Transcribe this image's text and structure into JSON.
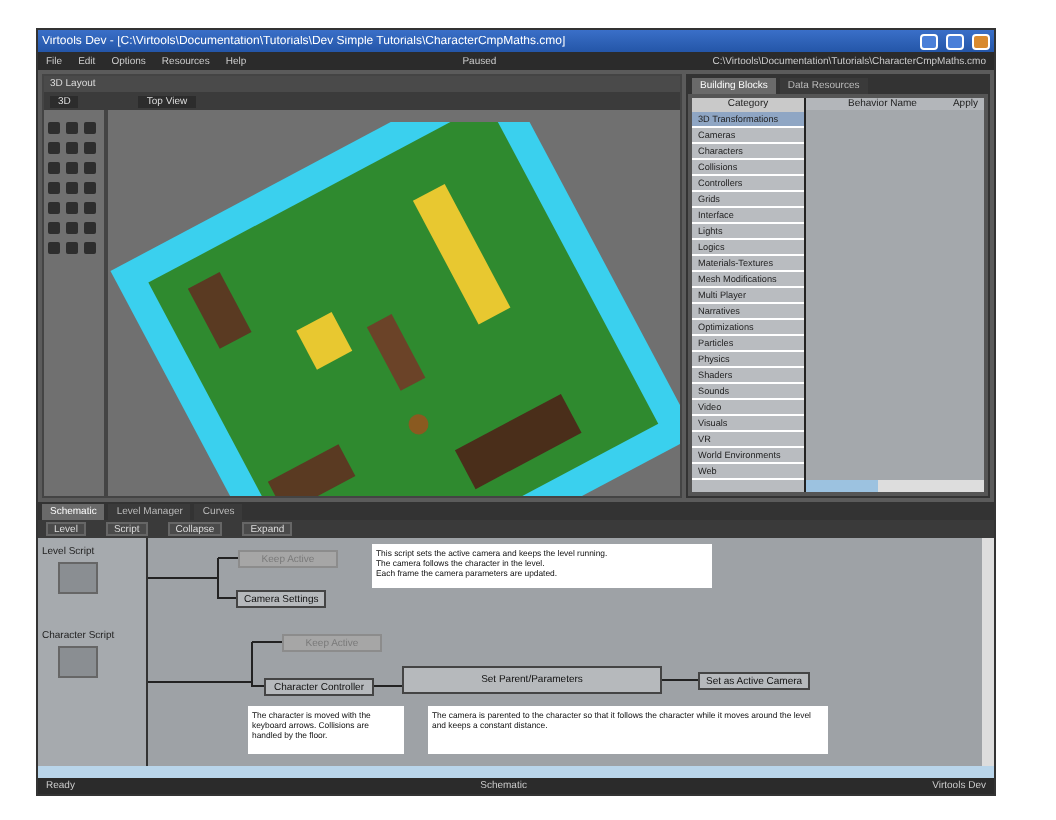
{
  "window": {
    "title": "Virtools Dev - [C:\\Virtools\\Documentation\\Tutorials\\Dev Simple Tutorials\\CharacterCmpMaths.cmo]"
  },
  "menu": [
    "File",
    "Edit",
    "Options",
    "Resources",
    "Help"
  ],
  "play_status": "Paused",
  "file_path": "C:\\Virtools\\Documentation\\Tutorials\\CharacterCmpMaths.cmo",
  "layout_panel": {
    "title": "3D Layout",
    "camera_field": "3D",
    "view_select": "Top View"
  },
  "building_blocks": {
    "tabs": [
      {
        "label": "Building Blocks",
        "selected": true
      },
      {
        "label": "Data Resources",
        "selected": false
      }
    ],
    "columns": [
      "Category",
      "Behavior Name",
      "Apply"
    ],
    "categories": [
      {
        "name": "3D Transformations",
        "selected": true
      },
      {
        "name": "Cameras",
        "selected": false
      },
      {
        "name": "Characters",
        "selected": false
      },
      {
        "name": "Collisions",
        "selected": false
      },
      {
        "name": "Controllers",
        "selected": false
      },
      {
        "name": "Grids",
        "selected": false
      },
      {
        "name": "Interface",
        "selected": false
      },
      {
        "name": "Lights",
        "selected": false
      },
      {
        "name": "Logics",
        "selected": false
      },
      {
        "name": "Materials-Textures",
        "selected": false
      },
      {
        "name": "Mesh Modifications",
        "selected": false
      },
      {
        "name": "Multi Player",
        "selected": false
      },
      {
        "name": "Narratives",
        "selected": false
      },
      {
        "name": "Optimizations",
        "selected": false
      },
      {
        "name": "Particles",
        "selected": false
      },
      {
        "name": "Physics",
        "selected": false
      },
      {
        "name": "Shaders",
        "selected": false
      },
      {
        "name": "Sounds",
        "selected": false
      },
      {
        "name": "Video",
        "selected": false
      },
      {
        "name": "Visuals",
        "selected": false
      },
      {
        "name": "VR",
        "selected": false
      },
      {
        "name": "World Environments",
        "selected": false
      },
      {
        "name": "Web",
        "selected": false
      }
    ]
  },
  "schematic": {
    "tabs": [
      {
        "label": "Schematic",
        "selected": true
      },
      {
        "label": "Level Manager",
        "selected": false
      },
      {
        "label": "Curves",
        "selected": false
      }
    ],
    "toolbar": [
      "Level",
      "Script",
      "Collapse",
      "Expand"
    ],
    "scripts": [
      {
        "name": "Level Script"
      },
      {
        "name": "Character Script"
      }
    ],
    "nodes": [
      {
        "label": "Keep Active",
        "dimmed": true
      },
      {
        "label": "Camera Settings",
        "dimmed": false
      },
      {
        "label": "Keep Active",
        "dimmed": true
      },
      {
        "label": "Character Controller",
        "dimmed": false
      },
      {
        "label": "Set Parent/Parameters",
        "dimmed": false
      },
      {
        "label": "Set as Active Camera",
        "dimmed": false
      }
    ],
    "comments": [
      "This script sets the active camera and keeps the level running.\nThe camera follows the character in the level.\nEach frame the camera parameters are updated.",
      "The character is moved with the keyboard arrows. Collisions are handled by the floor.",
      "The camera is parented to the character so that it follows the character while it moves around the level and keeps a constant distance."
    ]
  },
  "status_bar": {
    "left": "Ready",
    "center": "Schematic",
    "right": "Virtools Dev"
  }
}
